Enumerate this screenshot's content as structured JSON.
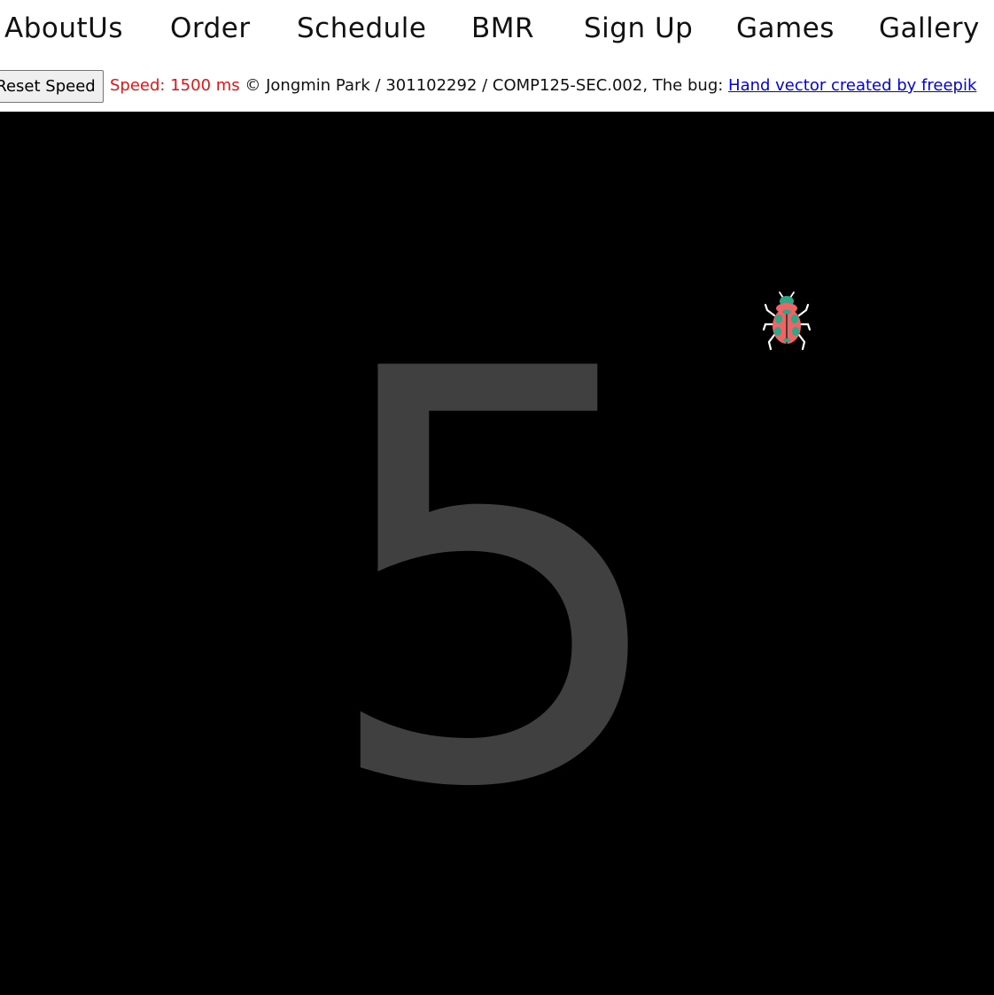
{
  "nav": {
    "items": [
      {
        "label": "AboutUs"
      },
      {
        "label": "Order"
      },
      {
        "label": "Schedule"
      },
      {
        "label": "BMR"
      },
      {
        "label": "Sign Up"
      },
      {
        "label": "Games"
      },
      {
        "label": "Gallery"
      }
    ]
  },
  "toolbar": {
    "reset_label": "Reset Speed",
    "speed_text": "Speed: 1500 ms",
    "copyright_text": "© Jongmin Park / 301102292 / COMP125-SEC.002, The bug: ",
    "credit_link_text": "Hand vector created by freepik"
  },
  "game": {
    "countdown": "5",
    "bug_icon": "bug-icon"
  },
  "colors": {
    "speed_text": "#ee1111",
    "game_background": "#000000",
    "countdown_digit": "#404040",
    "link": "#0000ee",
    "bug_shell": "#ef6464",
    "bug_marks": "#2aa88a"
  }
}
